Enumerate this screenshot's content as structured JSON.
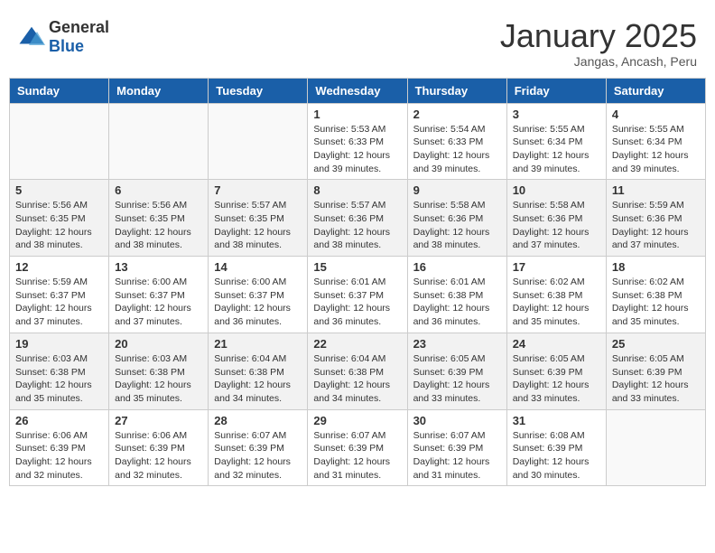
{
  "header": {
    "logo_general": "General",
    "logo_blue": "Blue",
    "title": "January 2025",
    "subtitle": "Jangas, Ancash, Peru"
  },
  "days_of_week": [
    "Sunday",
    "Monday",
    "Tuesday",
    "Wednesday",
    "Thursday",
    "Friday",
    "Saturday"
  ],
  "weeks": [
    {
      "days": [
        {
          "num": "",
          "sunrise": "",
          "sunset": "",
          "daylight": "",
          "empty": true
        },
        {
          "num": "",
          "sunrise": "",
          "sunset": "",
          "daylight": "",
          "empty": true
        },
        {
          "num": "",
          "sunrise": "",
          "sunset": "",
          "daylight": "",
          "empty": true
        },
        {
          "num": "1",
          "sunrise": "5:53 AM",
          "sunset": "6:33 PM",
          "daylight": "12 hours and 39 minutes."
        },
        {
          "num": "2",
          "sunrise": "5:54 AM",
          "sunset": "6:33 PM",
          "daylight": "12 hours and 39 minutes."
        },
        {
          "num": "3",
          "sunrise": "5:55 AM",
          "sunset": "6:34 PM",
          "daylight": "12 hours and 39 minutes."
        },
        {
          "num": "4",
          "sunrise": "5:55 AM",
          "sunset": "6:34 PM",
          "daylight": "12 hours and 39 minutes."
        }
      ]
    },
    {
      "days": [
        {
          "num": "5",
          "sunrise": "5:56 AM",
          "sunset": "6:35 PM",
          "daylight": "12 hours and 38 minutes."
        },
        {
          "num": "6",
          "sunrise": "5:56 AM",
          "sunset": "6:35 PM",
          "daylight": "12 hours and 38 minutes."
        },
        {
          "num": "7",
          "sunrise": "5:57 AM",
          "sunset": "6:35 PM",
          "daylight": "12 hours and 38 minutes."
        },
        {
          "num": "8",
          "sunrise": "5:57 AM",
          "sunset": "6:36 PM",
          "daylight": "12 hours and 38 minutes."
        },
        {
          "num": "9",
          "sunrise": "5:58 AM",
          "sunset": "6:36 PM",
          "daylight": "12 hours and 38 minutes."
        },
        {
          "num": "10",
          "sunrise": "5:58 AM",
          "sunset": "6:36 PM",
          "daylight": "12 hours and 37 minutes."
        },
        {
          "num": "11",
          "sunrise": "5:59 AM",
          "sunset": "6:36 PM",
          "daylight": "12 hours and 37 minutes."
        }
      ]
    },
    {
      "days": [
        {
          "num": "12",
          "sunrise": "5:59 AM",
          "sunset": "6:37 PM",
          "daylight": "12 hours and 37 minutes."
        },
        {
          "num": "13",
          "sunrise": "6:00 AM",
          "sunset": "6:37 PM",
          "daylight": "12 hours and 37 minutes."
        },
        {
          "num": "14",
          "sunrise": "6:00 AM",
          "sunset": "6:37 PM",
          "daylight": "12 hours and 36 minutes."
        },
        {
          "num": "15",
          "sunrise": "6:01 AM",
          "sunset": "6:37 PM",
          "daylight": "12 hours and 36 minutes."
        },
        {
          "num": "16",
          "sunrise": "6:01 AM",
          "sunset": "6:38 PM",
          "daylight": "12 hours and 36 minutes."
        },
        {
          "num": "17",
          "sunrise": "6:02 AM",
          "sunset": "6:38 PM",
          "daylight": "12 hours and 35 minutes."
        },
        {
          "num": "18",
          "sunrise": "6:02 AM",
          "sunset": "6:38 PM",
          "daylight": "12 hours and 35 minutes."
        }
      ]
    },
    {
      "days": [
        {
          "num": "19",
          "sunrise": "6:03 AM",
          "sunset": "6:38 PM",
          "daylight": "12 hours and 35 minutes."
        },
        {
          "num": "20",
          "sunrise": "6:03 AM",
          "sunset": "6:38 PM",
          "daylight": "12 hours and 35 minutes."
        },
        {
          "num": "21",
          "sunrise": "6:04 AM",
          "sunset": "6:38 PM",
          "daylight": "12 hours and 34 minutes."
        },
        {
          "num": "22",
          "sunrise": "6:04 AM",
          "sunset": "6:38 PM",
          "daylight": "12 hours and 34 minutes."
        },
        {
          "num": "23",
          "sunrise": "6:05 AM",
          "sunset": "6:39 PM",
          "daylight": "12 hours and 33 minutes."
        },
        {
          "num": "24",
          "sunrise": "6:05 AM",
          "sunset": "6:39 PM",
          "daylight": "12 hours and 33 minutes."
        },
        {
          "num": "25",
          "sunrise": "6:05 AM",
          "sunset": "6:39 PM",
          "daylight": "12 hours and 33 minutes."
        }
      ]
    },
    {
      "days": [
        {
          "num": "26",
          "sunrise": "6:06 AM",
          "sunset": "6:39 PM",
          "daylight": "12 hours and 32 minutes."
        },
        {
          "num": "27",
          "sunrise": "6:06 AM",
          "sunset": "6:39 PM",
          "daylight": "12 hours and 32 minutes."
        },
        {
          "num": "28",
          "sunrise": "6:07 AM",
          "sunset": "6:39 PM",
          "daylight": "12 hours and 32 minutes."
        },
        {
          "num": "29",
          "sunrise": "6:07 AM",
          "sunset": "6:39 PM",
          "daylight": "12 hours and 31 minutes."
        },
        {
          "num": "30",
          "sunrise": "6:07 AM",
          "sunset": "6:39 PM",
          "daylight": "12 hours and 31 minutes."
        },
        {
          "num": "31",
          "sunrise": "6:08 AM",
          "sunset": "6:39 PM",
          "daylight": "12 hours and 30 minutes."
        },
        {
          "num": "",
          "sunrise": "",
          "sunset": "",
          "daylight": "",
          "empty": true
        }
      ]
    }
  ]
}
